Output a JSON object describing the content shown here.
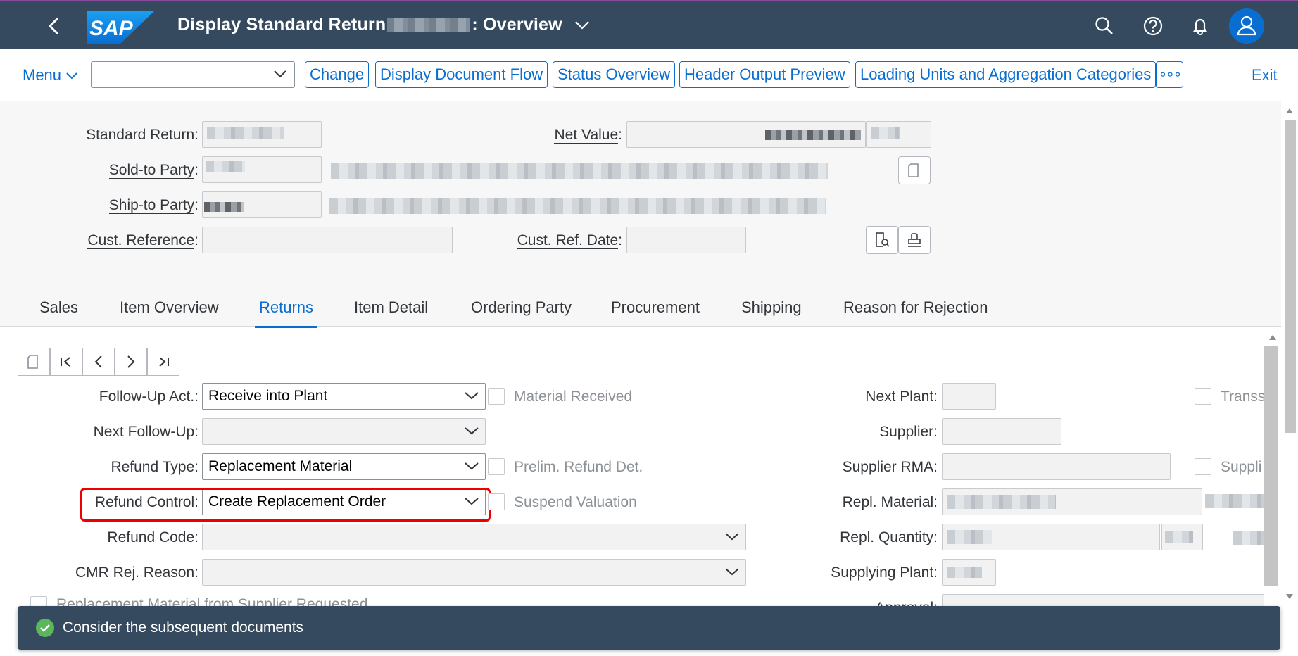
{
  "shell": {
    "title_prefix": "Display Standard Return",
    "title_suffix": ": Overview",
    "icons": [
      "back-icon",
      "search-icon",
      "help-icon",
      "notification-icon",
      "user-icon"
    ],
    "brand_color": "#354a5f"
  },
  "toolbar": {
    "menu_label": "Menu",
    "select_value": "",
    "buttons": [
      "Change",
      "Display Document Flow",
      "Status Overview",
      "Header Output Preview",
      "Loading Units and Aggregation Categories"
    ],
    "more_label": "∘∘∘",
    "exit_label": "Exit"
  },
  "header": {
    "standard_return_label": "Standard Return:",
    "net_value_label": "Net Value",
    "sold_to_label": "Sold-to Party",
    "ship_to_label": "Ship-to Party",
    "cust_ref_label": "Cust. Reference",
    "cust_ref_date_label": "Cust. Ref. Date",
    "cust_reference_value": "",
    "cust_ref_date_value": ""
  },
  "tabs": [
    {
      "label": "Sales",
      "selected": false
    },
    {
      "label": "Item Overview",
      "selected": false
    },
    {
      "label": "Returns",
      "selected": true
    },
    {
      "label": "Item Detail",
      "selected": false
    },
    {
      "label": "Ordering Party",
      "selected": false
    },
    {
      "label": "Procurement",
      "selected": false
    },
    {
      "label": "Shipping",
      "selected": false
    },
    {
      "label": "Reason for Rejection",
      "selected": false
    }
  ],
  "returns": {
    "follow_up_label": "Follow-Up Act.:",
    "follow_up_value": "Receive into Plant",
    "next_follow_up_label": "Next Follow-Up:",
    "next_follow_up_value": "",
    "refund_type_label": "Refund Type:",
    "refund_type_value": "Replacement Material",
    "refund_control_label": "Refund Control:",
    "refund_control_value": "Create Replacement Order",
    "refund_code_label": "Refund Code:",
    "refund_code_value": "",
    "cmr_label": "CMR Rej. Reason:",
    "cmr_value": "",
    "replacement_from_supplier_label": "Replacement Material from Supplier Requested",
    "material_received_label": "Material Received",
    "prelim_refund_label": "Prelim. Refund Det.",
    "suspend_valuation_label": "Suspend Valuation",
    "next_plant_label": "Next Plant:",
    "supplier_label": "Supplier:",
    "supplier_rma_label": "Supplier RMA:",
    "repl_material_label": "Repl. Material:",
    "repl_quantity_label": "Repl. Quantity:",
    "supplying_plant_label": "Supplying Plant:",
    "approval_label": "Approval:",
    "trans_label": "Transs",
    "suppli_label": "Suppli"
  },
  "message": {
    "text": "Consider the subsequent documents",
    "status_color": "#5bb75b"
  }
}
